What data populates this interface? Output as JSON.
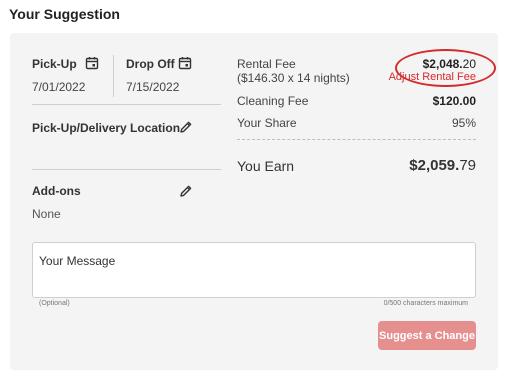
{
  "page": {
    "title": "Your Suggestion"
  },
  "dates": {
    "pickup_label": "Pick-Up",
    "pickup_value": "7/01/2022",
    "dropoff_label": "Drop Off",
    "dropoff_value": "7/15/2022"
  },
  "location": {
    "label": "Pick-Up/Delivery Location"
  },
  "addons": {
    "label": "Add-ons",
    "value": "None"
  },
  "fees": {
    "rental_fee_label": "Rental Fee",
    "rental_fee_detail": "($146.30 x 14 nights)",
    "rental_fee_whole": "$2,048.",
    "rental_fee_cents": "20",
    "adjust_link": "Adjust Rental Fee",
    "cleaning_fee_label": "Cleaning Fee",
    "cleaning_fee_value": "$120.00",
    "share_label": "Your Share",
    "share_value": "95%",
    "earn_label": "You Earn",
    "earn_whole": "$2,059.",
    "earn_cents": "79"
  },
  "message": {
    "placeholder": "Your Message",
    "optional_hint": "(Optional)",
    "char_hint": "0/500 characters maximum"
  },
  "actions": {
    "suggest_label": "Suggest a Change"
  },
  "colors": {
    "accent": "#d42a2a",
    "button_bg": "#e58f8f",
    "card_bg": "#f4f4f5"
  },
  "icons": {
    "pickup": "calendar-icon",
    "dropoff": "calendar-icon",
    "location_edit": "pencil-icon",
    "addons_edit": "pencil-icon"
  }
}
